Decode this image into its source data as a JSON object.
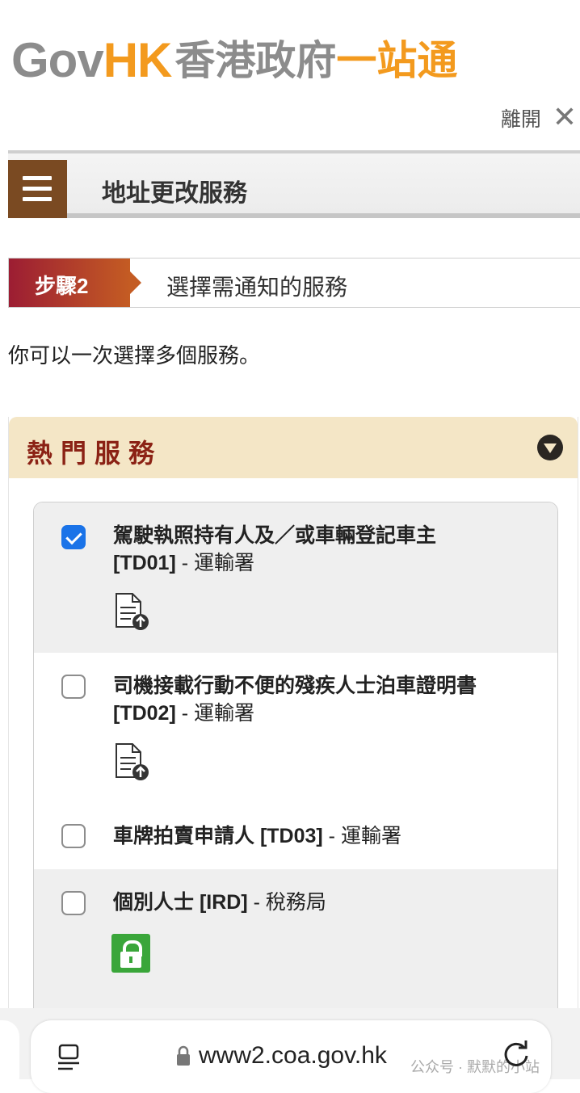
{
  "header": {
    "logo_gov": "Gov",
    "logo_hk": "HK",
    "logo_cn_1": "香港政府",
    "logo_cn_2": "一站通",
    "exit_label": "離開"
  },
  "service_bar": {
    "title": "地址更改服務"
  },
  "step": {
    "badge": "步驟2",
    "title": "選擇需通知的服務"
  },
  "intro": "你可以一次選擇多個服務。",
  "accordion": {
    "title": "熱門服務",
    "items": [
      {
        "name": "駕駛執照持有人及／或車輛登記車主 [TD01]",
        "dept": " - 運輸署",
        "checked": true,
        "icon": "document-upload-icon"
      },
      {
        "name": "司機接載行動不便的殘疾人士泊車證明書 [TD02]",
        "dept": " - 運輸署",
        "checked": false,
        "icon": "document-upload-icon"
      },
      {
        "name": "車牌拍賣申請人 [TD03]",
        "dept": " - 運輸署",
        "checked": false,
        "icon": ""
      },
      {
        "name": "個別人士 [IRD]",
        "dept": " - 稅務局",
        "checked": false,
        "icon": "lock-icon"
      }
    ]
  },
  "browser": {
    "url": "www2.coa.gov.hk",
    "watermark": "公众号 · 默默的小站"
  }
}
